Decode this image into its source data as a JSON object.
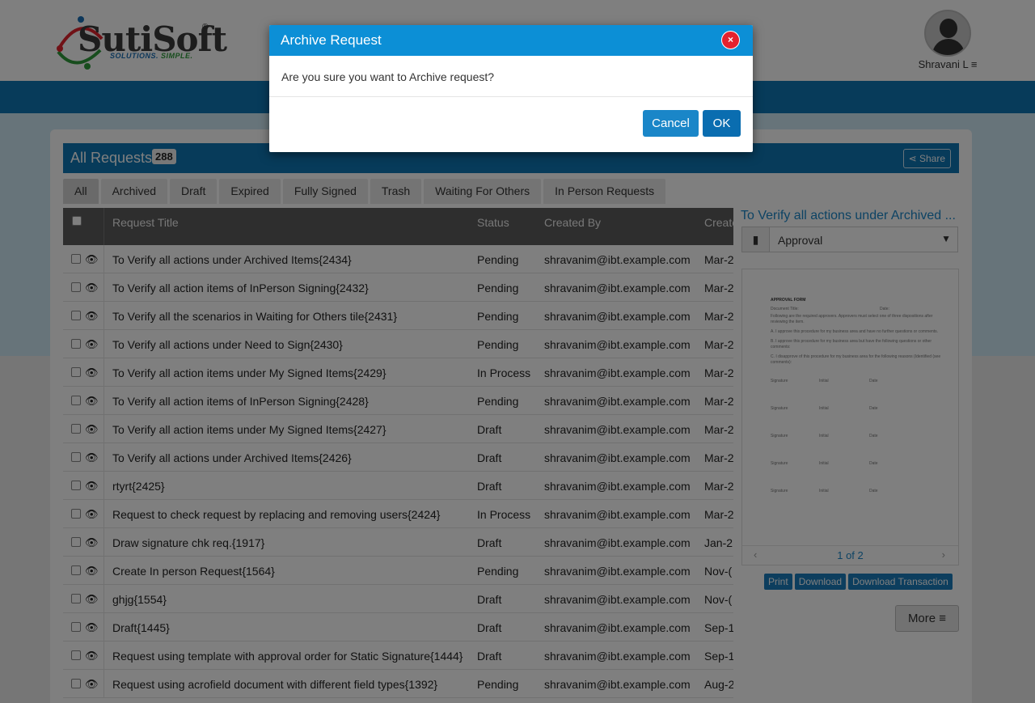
{
  "brand": {
    "logo_text": "SutiSoft",
    "reg": "®",
    "tagline_a": "SOLUTIONS.",
    "tagline_b": "SIMPLE."
  },
  "user": {
    "name": "Shravani L ≡"
  },
  "panel": {
    "title": "All Requests",
    "count": "288",
    "share_label": "Share"
  },
  "tabs": [
    "All",
    "Archived",
    "Draft",
    "Expired",
    "Fully Signed",
    "Trash",
    "Waiting For Others",
    "In Person Requests"
  ],
  "table": {
    "headers": {
      "title": "Request Title",
      "status": "Status",
      "created_by": "Created By",
      "created_on": "Create"
    },
    "rows": [
      {
        "title": "To Verify all actions under Archived Items{2434}",
        "status": "Pending",
        "by": "shravanim@ibt.example.com",
        "date": "Mar-2"
      },
      {
        "title": "To Verify all action items of InPerson Signing{2432}",
        "status": "Pending",
        "by": "shravanim@ibt.example.com",
        "date": "Mar-2"
      },
      {
        "title": "To Verify all the scenarios in Waiting for Others tile{2431}",
        "status": "Pending",
        "by": "shravanim@ibt.example.com",
        "date": "Mar-2"
      },
      {
        "title": "To Verify all actions under Need to Sign{2430}",
        "status": "Pending",
        "by": "shravanim@ibt.example.com",
        "date": "Mar-2"
      },
      {
        "title": "To Verify all action items under My Signed Items{2429}",
        "status": "In Process",
        "by": "shravanim@ibt.example.com",
        "date": "Mar-2"
      },
      {
        "title": "To Verify all action items of InPerson Signing{2428}",
        "status": "Pending",
        "by": "shravanim@ibt.example.com",
        "date": "Mar-2"
      },
      {
        "title": "To Verify all action items under My Signed Items{2427}",
        "status": "Draft",
        "by": "shravanim@ibt.example.com",
        "date": "Mar-2"
      },
      {
        "title": "To Verify all actions under Archived Items{2426}",
        "status": "Draft",
        "by": "shravanim@ibt.example.com",
        "date": "Mar-2"
      },
      {
        "title": "rtyrt{2425}",
        "status": "Draft",
        "by": "shravanim@ibt.example.com",
        "date": "Mar-2"
      },
      {
        "title": "Request to check request by replacing and removing users{2424}",
        "status": "In Process",
        "by": "shravanim@ibt.example.com",
        "date": "Mar-2"
      },
      {
        "title": "Draw signature chk req.{1917}",
        "status": "Draft",
        "by": "shravanim@ibt.example.com",
        "date": "Jan-2"
      },
      {
        "title": "Create In person Request{1564}",
        "status": "Pending",
        "by": "shravanim@ibt.example.com",
        "date": "Nov-("
      },
      {
        "title": "ghjg{1554}",
        "status": "Draft",
        "by": "shravanim@ibt.example.com",
        "date": "Nov-("
      },
      {
        "title": "Draft{1445}",
        "status": "Draft",
        "by": "shravanim@ibt.example.com",
        "date": "Sep-1"
      },
      {
        "title": "Request using template with approval order for Static Signature{1444}",
        "status": "Draft",
        "by": "shravanim@ibt.example.com",
        "date": "Sep-1"
      },
      {
        "title": "Request using acrofield document with different field types{1392}",
        "status": "Pending",
        "by": "shravanim@ibt.example.com",
        "date": "Aug-2"
      }
    ]
  },
  "preview": {
    "title": "To Verify all actions under Archived ...",
    "doc_select": "Approval",
    "page_indicator": "1 of 2",
    "doc_lines": {
      "heading": "APPROVAL FORM",
      "l1": "Document Title:",
      "l1b": "Date:",
      "l2": "Following are the required approvers. Approvers must select one of three dispositions after",
      "l3": "reviewing the item.",
      "l4": "A. I approve this procedure for my business area and have no further questions or comments.",
      "l5": "B. I approve this procedure for my business area but have the following questions or other",
      "l5b": "comments:",
      "l6": "C. I disapprove of this procedure for my business area for the following reasons (Identified (see",
      "l6b": "comments):",
      "sig": "Signature",
      "ini": "Initial",
      "dt": "Date"
    },
    "actions": [
      "Print",
      "Download",
      "Download Transaction"
    ],
    "more_label": "More ≡"
  },
  "modal": {
    "title": "Archive Request",
    "message": "Are you sure you want to Archive request?",
    "cancel": "Cancel",
    "ok": "OK",
    "close": "×"
  },
  "colors": {
    "primary": "#0f76b5",
    "modal_header": "#0c8fd6",
    "close": "#e4212e"
  }
}
